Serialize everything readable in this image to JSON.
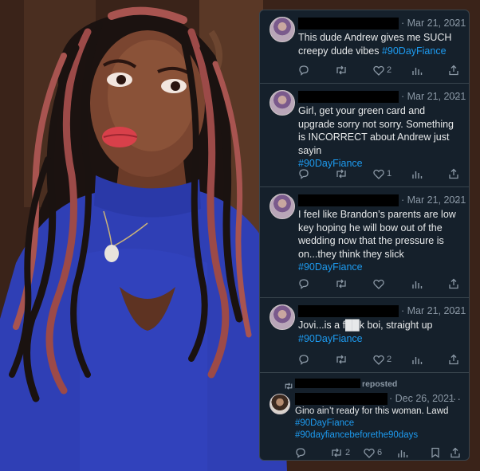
{
  "tweets": [
    {
      "date": "· Mar 21, 2021",
      "more": "···",
      "text": "This dude Andrew gives me SUCH creepy dude vibes",
      "hashtags": [
        "#90DayFiance"
      ],
      "likes": "2",
      "retweets": "",
      "views": ""
    },
    {
      "date": "· Mar 21, 2021",
      "more": "···",
      "text": "Girl, get your green card and upgrade sorry not sorry. Something is INCORRECT about Andrew just sayin",
      "hashtags": [
        "#90DayFiance"
      ],
      "likes": "1",
      "retweets": "",
      "views": ""
    },
    {
      "date": "· Mar 21, 2021",
      "more": "···",
      "text": "I feel like Brandon’s parents are low key hoping he will bow out of the wedding now that the pressure is on...they think they slick",
      "hashtags": [
        "#90DayFiance"
      ],
      "likes": "",
      "retweets": "",
      "views": ""
    },
    {
      "date": "· Mar 21, 2021",
      "more": "···",
      "text": "Jovi...is a f██k boi, straight up",
      "hashtags": [
        "#90DayFiance"
      ],
      "likes": "2",
      "retweets": "",
      "views": ""
    },
    {
      "repost_label": "reposted",
      "date": "· Dec 26, 2021",
      "more": "···",
      "text": "Gino ain’t ready for this woman. Lawd",
      "hashtags": [
        "#90DayFiance",
        "#90dayfiancebeforethe90days"
      ],
      "likes": "6",
      "retweets": "2",
      "views": ""
    }
  ],
  "colors": {
    "panel_bg": "#15202b",
    "border": "#38444d",
    "text": "#e7e9ea",
    "muted": "#8b98a5",
    "hashtag": "#1d9bf0",
    "sweater": "#2f3fb5"
  },
  "icons": [
    "reply-icon",
    "retweet-icon",
    "like-icon",
    "views-icon",
    "share-icon",
    "bookmark-icon",
    "more-icon"
  ]
}
